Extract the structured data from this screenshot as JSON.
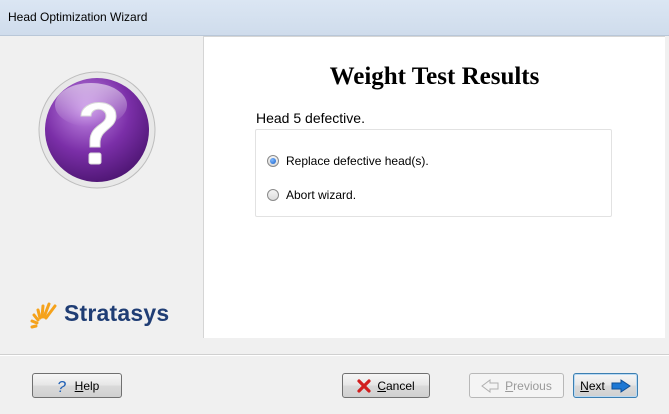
{
  "window": {
    "title": "Head Optimization Wizard"
  },
  "branding": {
    "logo_text": "Stratasys"
  },
  "content": {
    "heading": "Weight Test Results",
    "message": "Head 5 defective.",
    "options": [
      {
        "label": "Replace defective head(s).",
        "selected": true
      },
      {
        "label": "Abort wizard.",
        "selected": false
      }
    ]
  },
  "buttons": {
    "help": {
      "label": "Help",
      "mnemonic": "H",
      "rest": "elp"
    },
    "cancel": {
      "label": "Cancel",
      "mnemonic": "C",
      "rest": "ancel"
    },
    "previous": {
      "label": "Previous",
      "mnemonic": "P",
      "rest": "revious",
      "enabled": false
    },
    "next": {
      "label": "Next",
      "mnemonic": "N",
      "rest": "ext"
    }
  },
  "icons": {
    "question": "question-icon",
    "help": "question-mark-icon",
    "cancel": "red-x-icon",
    "previous": "arrow-left-icon",
    "next": "arrow-right-icon"
  },
  "colors": {
    "question_purple": "#7b2fa8",
    "logo_blue": "#1f3d74",
    "logo_orange": "#f5a21b",
    "next_arrow": "#1e78d4",
    "cancel_red": "#d21f1f"
  }
}
